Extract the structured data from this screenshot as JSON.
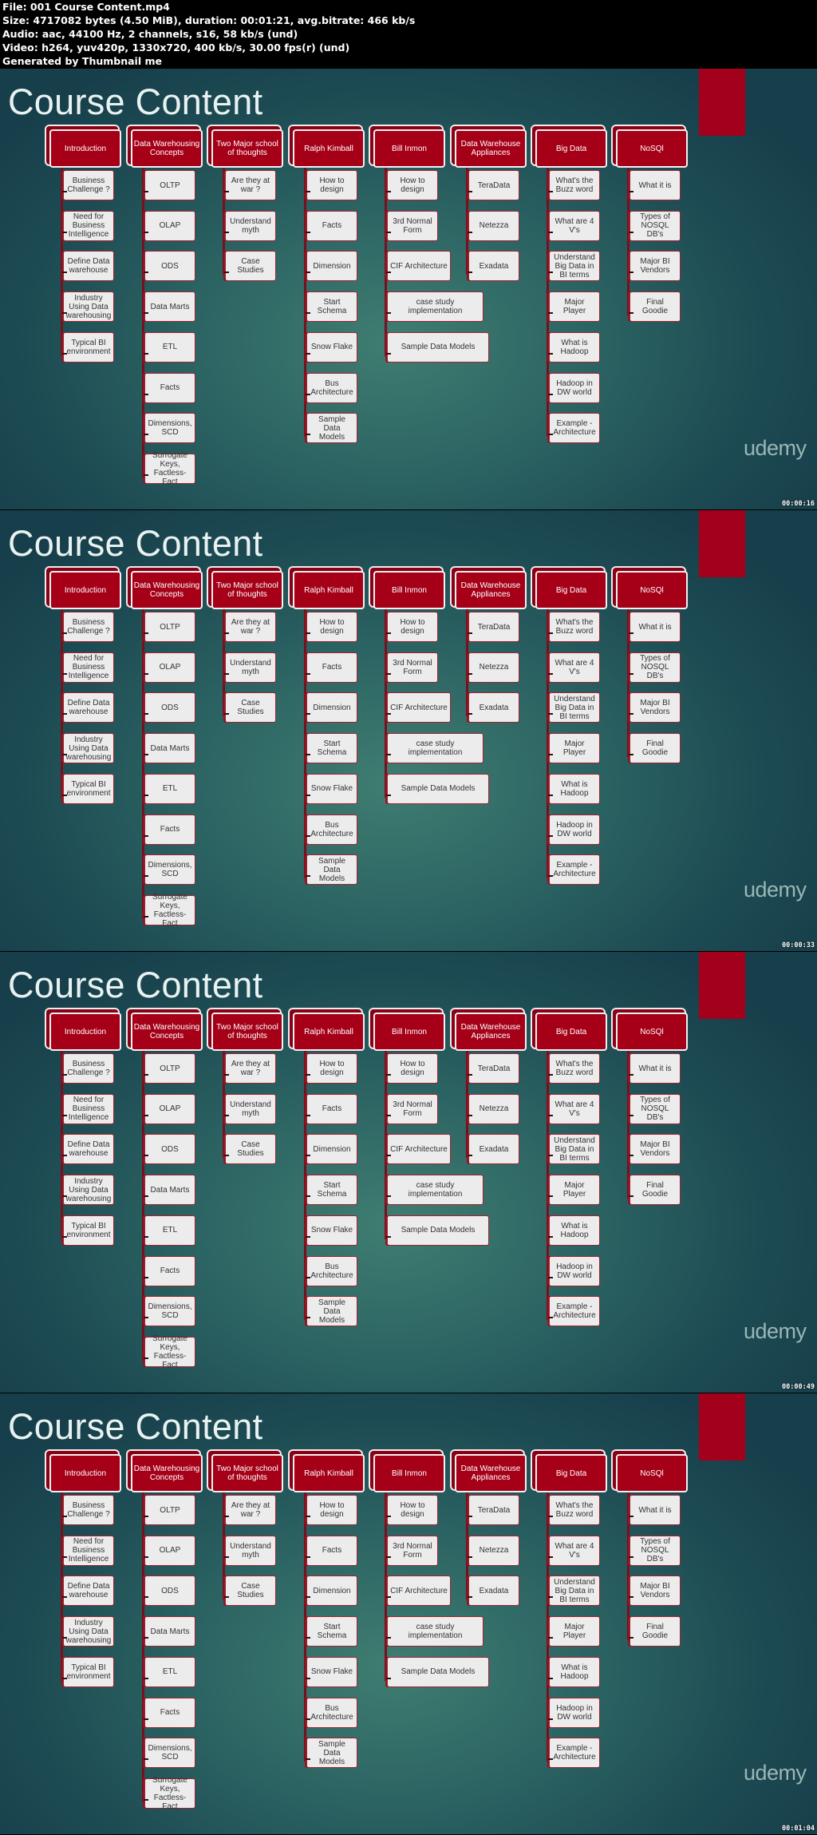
{
  "file_info": {
    "lines": [
      "File: 001 Course Content.mp4",
      "Size: 4717082 bytes (4.50 MiB), duration: 00:01:21, avg.bitrate: 466 kb/s",
      "Audio: aac, 44100 Hz, 2 channels, s16, 58 kb/s (und)",
      "Video: h264, yuv420p, 1330x720, 400 kb/s, 30.00 fps(r) (und)",
      "Generated by Thumbnail me"
    ]
  },
  "slide": {
    "title": "Course Content",
    "logo": "udemy",
    "accent_color": "#a50018",
    "columns": [
      {
        "header": "Introduction",
        "items": [
          "Business Challenge ?",
          "Need for Business Intelligence",
          "Define Data warehouse",
          "Industry Using Data warehousing",
          "Typical BI environment"
        ]
      },
      {
        "header": "Data Warehousing Concepts",
        "items": [
          "OLTP",
          "OLAP",
          "ODS",
          "Data Marts",
          "ETL",
          "Facts",
          "Dimensions, SCD",
          "Surrogate Keys, Factless-Fact"
        ]
      },
      {
        "header": "Two Major school of thoughts",
        "items": [
          "Are they at war ?",
          "Understand myth",
          "Case Studies"
        ]
      },
      {
        "header": "Ralph Kimball",
        "items": [
          "How to design",
          "Facts",
          "Dimension",
          "Start Schema",
          "Snow Flake",
          "Bus Architecture",
          "Sample Data Models"
        ]
      },
      {
        "header": "Bill Inmon",
        "items": [
          "How to design",
          "3rd Normal Form",
          "CIF Architecture",
          "case study implementation",
          "Sample Data Models"
        ]
      },
      {
        "header": "Data Warehouse Appliances",
        "items": [
          "TeraData",
          "Netezza",
          "Exadata"
        ]
      },
      {
        "header": "Big Data",
        "items": [
          "What's the Buzz word",
          "What are 4 V's",
          "Understand Big Data in BI terms",
          "Major Player",
          "What is Hadoop",
          "Hadoop in DW world",
          "Example - Architecture"
        ]
      },
      {
        "header": "NoSQl",
        "items": [
          "What it is",
          "Types of NOSQL DB's",
          "Major BI Vendors",
          "Final Goodie"
        ]
      }
    ]
  },
  "frames": [
    {
      "timestamp": "00:00:16"
    },
    {
      "timestamp": "00:00:33"
    },
    {
      "timestamp": "00:00:49"
    },
    {
      "timestamp": "00:01:04"
    }
  ]
}
